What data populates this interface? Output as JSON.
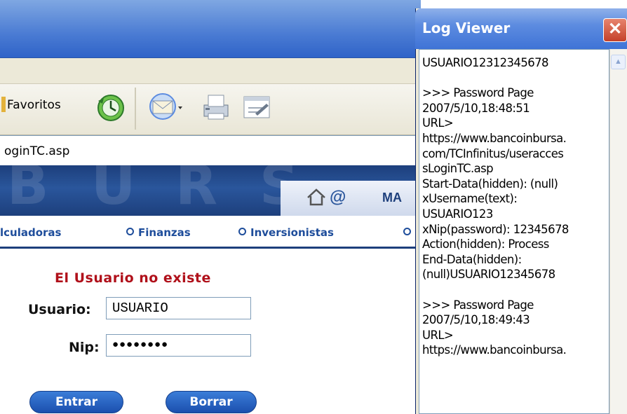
{
  "browser": {
    "favorites_label": "Favoritos",
    "address": "oginTC.asp"
  },
  "banner": {
    "watermark_letters": [
      "B",
      "U",
      "R",
      "S"
    ],
    "ma_text": "MA"
  },
  "nav": {
    "links": [
      "lculadoras",
      "Finanzas",
      "Inversionistas",
      ""
    ]
  },
  "form": {
    "error_message": "El Usuario no existe",
    "usuario_label": "Usuario:",
    "usuario_value": "USUARIO",
    "nip_label": "Nip:",
    "nip_value": "●●●●●●●●",
    "entrar_label": "Entrar",
    "borrar_label": "Borrar"
  },
  "log_viewer": {
    "title": "Log Viewer",
    "close_glyph": "✕",
    "lines": [
      "USUARIO12312345678",
      "",
      ">>> Password Page",
      "2007/5/10,18:48:51",
      "URL>",
      "https://www.bancoinbursa.",
      "com/TCInfinitus/useracces",
      "sLoginTC.asp",
      "Start-Data(hidden): (null)",
      "xUsername(text):",
      "USUARIO123",
      "xNip(password): 12345678",
      "Action(hidden): Process",
      "End-Data(hidden):",
      "(null)USUARIO12345678",
      "",
      ">>> Password Page",
      "2007/5/10,18:49:43",
      "URL>",
      "https://www.bancoinbursa."
    ]
  },
  "icons": [
    "history-icon",
    "mail-icon",
    "print-icon",
    "edit-icon",
    "home-icon",
    "at-icon",
    "close-icon"
  ]
}
